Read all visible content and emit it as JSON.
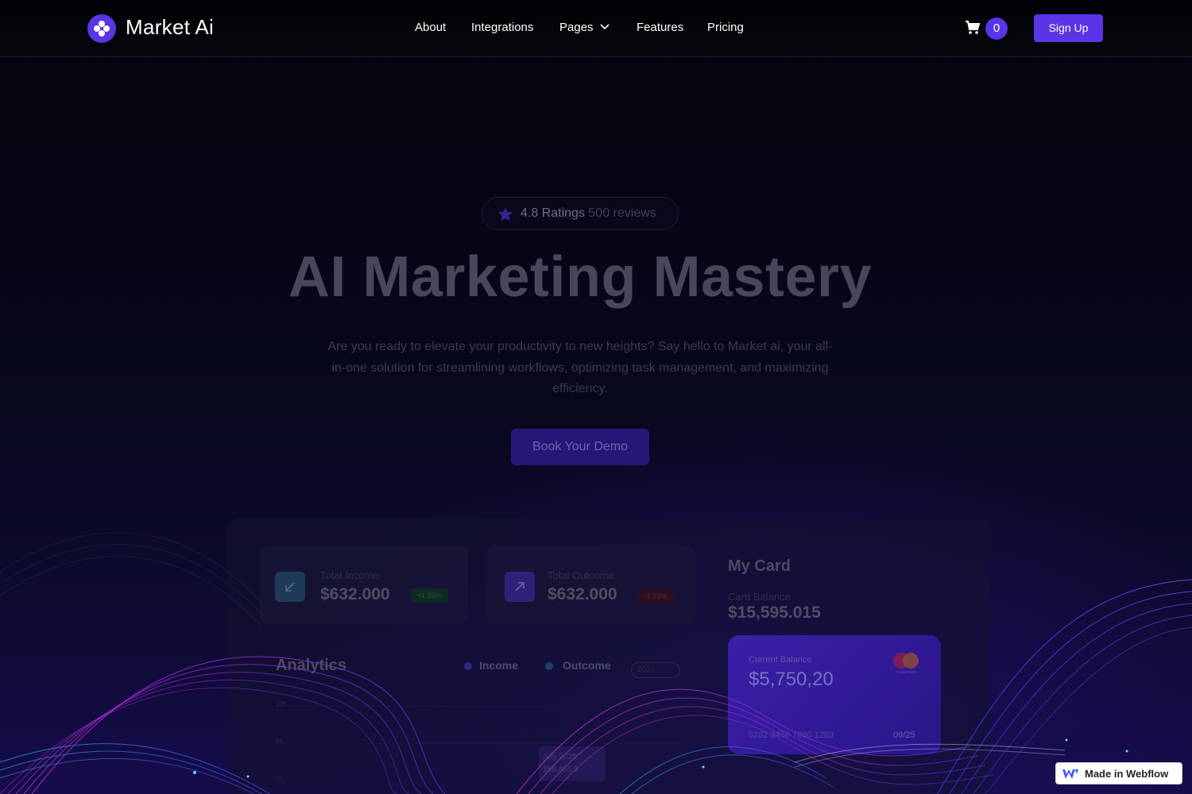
{
  "brand": {
    "name": "Market Ai",
    "accent": "#5a35e6"
  },
  "nav": {
    "links": [
      "About",
      "Integrations",
      "Pages",
      "Features",
      "Pricing"
    ],
    "cart_count": "0",
    "signup_label": "Sign Up"
  },
  "hero": {
    "rating_score": "4.8 Ratings",
    "rating_reviews": "500 reviews",
    "title": "AI Marketing Mastery",
    "description": "Are you ready to elevate your productivity to new heights? Say hello to Market ai, your all-in-one solution for streamlining workflows, optimizing task management, and maximizing efficiency.",
    "cta_label": "Book Your Demo"
  },
  "dashboard": {
    "income": {
      "label": "Total Income",
      "value": "$632.000",
      "change": "+1.29%"
    },
    "outcome": {
      "label": "Total Outcome",
      "value": "$632.000",
      "change": "-1.29%"
    },
    "my_card": {
      "title": "My Card",
      "balance_label": "Card Balance",
      "balance_value": "$15,595.015",
      "current_label": "Current Balance",
      "current_value": "$5,750,20",
      "card_number": "5282 3456 7890 1289",
      "expiry": "09/25",
      "network": "mastercard"
    },
    "analytics": {
      "title": "Analytics",
      "legend_income": "Income",
      "legend_outcome": "Outcome",
      "year": "2020",
      "y_ticks": [
        "10K",
        "8K",
        "6K"
      ],
      "tooltip_date": "July 2020",
      "tooltip_value": "$56,456.9"
    }
  },
  "badge": {
    "text": "Made in Webflow"
  },
  "icons": [
    "logo-icon",
    "chevron-down-icon",
    "cart-icon",
    "star-icon",
    "arrow-down-left-icon",
    "arrow-up-right-icon",
    "mastercard-icon",
    "webflow-icon"
  ]
}
